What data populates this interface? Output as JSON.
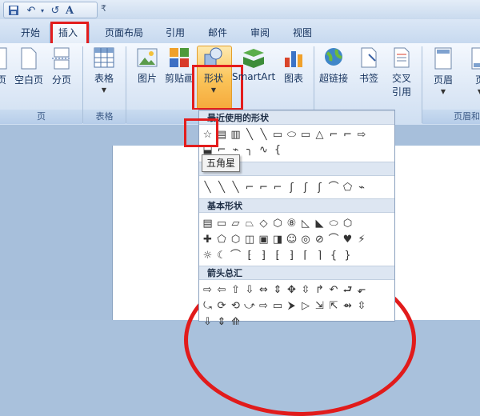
{
  "qat": {
    "save_icon": "save-icon",
    "undo_icon": "undo-icon",
    "redo_icon": "redo-icon",
    "font_glyph": "A"
  },
  "tabs": [
    "开始",
    "插入",
    "页面布局",
    "引用",
    "邮件",
    "审阅",
    "视图"
  ],
  "active_tab": "插入",
  "ribbon": {
    "pages": [
      "页",
      "空白页",
      "分页"
    ],
    "table": "表格",
    "illustrations": [
      "图片",
      "剪贴画",
      "形状",
      "SmartArt",
      "图表"
    ],
    "links": [
      "超链接",
      "书签",
      "交叉",
      "引用"
    ],
    "header": [
      "页眉",
      "页"
    ],
    "groups": [
      "页",
      "表格",
      "页眉和"
    ]
  },
  "shapes_panel": {
    "recent_title": "最近使用的形状",
    "basic_title": "基本形状",
    "arrows_title": "箭头总汇",
    "tooltip": "五角星",
    "recent_row1": [
      "☆",
      "▤",
      "▥",
      "╲",
      "╲",
      "▭",
      "⬭",
      "▭",
      "△",
      "⌐",
      "⌐",
      "⇨"
    ],
    "recent_row2": [
      "⬓",
      "⌐",
      "⌁",
      "╮",
      "∿",
      "{"
    ],
    "lines_row": [
      "╲",
      "╲",
      "╲",
      "⌐",
      "⌐",
      "⌐",
      "ʃ",
      "ʃ",
      "ʃ",
      "⌒",
      "⬠",
      "⌁"
    ],
    "basic_row1": [
      "▤",
      "▭",
      "▱",
      "⏢",
      "◇",
      "⬡",
      "⑧",
      "◺",
      "◣",
      "⬭",
      "⬡"
    ],
    "basic_row2": [
      "✚",
      "⬠",
      "⬡",
      "◫",
      "▣",
      "◨",
      "☺",
      "◎",
      "⊘",
      "⌒",
      "♥",
      "⚡"
    ],
    "basic_row3": [
      "☼",
      "☾",
      "⌒",
      "⁅",
      "⁆",
      "⁅",
      "⁆",
      "⌈",
      "⌉",
      "{",
      "}"
    ],
    "arrows_row1": [
      "⇨",
      "⇦",
      "⇧",
      "⇩",
      "⇔",
      "⇕",
      "✥",
      "⇳",
      "↱",
      "↶",
      "⮐",
      "⬐"
    ],
    "arrows_row2": [
      "⤿",
      "⟳",
      "⟲",
      "⤻",
      "⇨",
      "▭",
      "⮞",
      "▷",
      "⇲",
      "⇱",
      "⇴",
      "⇳"
    ],
    "arrows_row3": [
      "⇩",
      "⇕",
      "⟰"
    ]
  },
  "colors": {
    "accent_red": "#e31d1d",
    "ribbon": "#dde8f6",
    "selected": "#fbc55a"
  }
}
